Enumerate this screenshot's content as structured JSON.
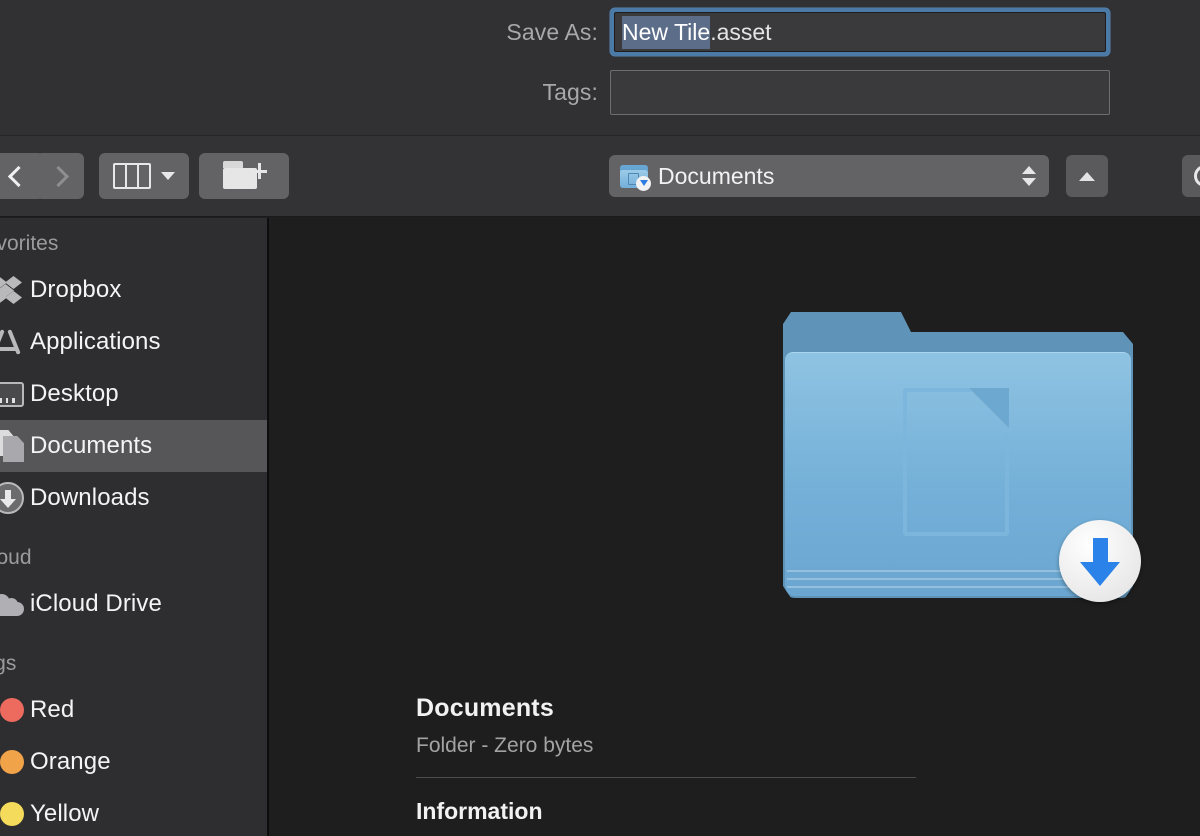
{
  "header": {
    "save_as_label": "Save As:",
    "filename_selected": "New Tile",
    "filename_extension": ".asset",
    "tags_label": "Tags:",
    "tags_value": "",
    "tags_placeholder": ""
  },
  "toolbar": {
    "back_icon": "chevron-left-icon",
    "forward_icon": "chevron-right-icon",
    "view_mode_icon": "column-view-icon",
    "view_mode_caret_icon": "chevron-down-icon",
    "new_folder_icon": "new-folder-icon",
    "path_label": "Documents",
    "path_icon": "documents-folder-icon",
    "path_stepper_icon": "up-down-chevron-icon",
    "up_button_icon": "chevron-up-icon",
    "search_icon": "search-icon"
  },
  "sidebar": {
    "sections": [
      {
        "title": "Favorites",
        "items": [
          {
            "label": "Dropbox",
            "icon": "dropbox-icon",
            "selected": false
          },
          {
            "label": "Applications",
            "icon": "applications-icon",
            "selected": false
          },
          {
            "label": "Desktop",
            "icon": "desktop-icon",
            "selected": false
          },
          {
            "label": "Documents",
            "icon": "documents-icon",
            "selected": true
          },
          {
            "label": "Downloads",
            "icon": "downloads-icon",
            "selected": false
          }
        ]
      },
      {
        "title": "iCloud",
        "items": [
          {
            "label": "iCloud Drive",
            "icon": "cloud-icon",
            "selected": false
          }
        ]
      },
      {
        "title": "Tags",
        "items": [
          {
            "label": "Red",
            "icon": "tag-dot-icon",
            "color": "#ed6a5e",
            "selected": false
          },
          {
            "label": "Orange",
            "icon": "tag-dot-icon",
            "color": "#f0a348",
            "selected": false
          },
          {
            "label": "Yellow",
            "icon": "tag-dot-icon",
            "color": "#f5db5c",
            "selected": false
          }
        ]
      }
    ]
  },
  "preview": {
    "folder_icon": "documents-folder-large-icon",
    "folder_badge_icon": "download-badge-icon",
    "title": "Documents",
    "subtitle": "Folder - Zero bytes",
    "section_title": "Information"
  },
  "colors": {
    "accent_blue": "#2b82e8",
    "focus_ring": "#4a7aa5",
    "selection_highlight": "#5b6d88",
    "sidebar_bg": "#2e2e30",
    "toolbar_bg": "#333336",
    "header_bg": "#313134",
    "content_bg": "#1e1e1e",
    "selected_row": "#565659",
    "folder_blue": "#74b0d8"
  }
}
